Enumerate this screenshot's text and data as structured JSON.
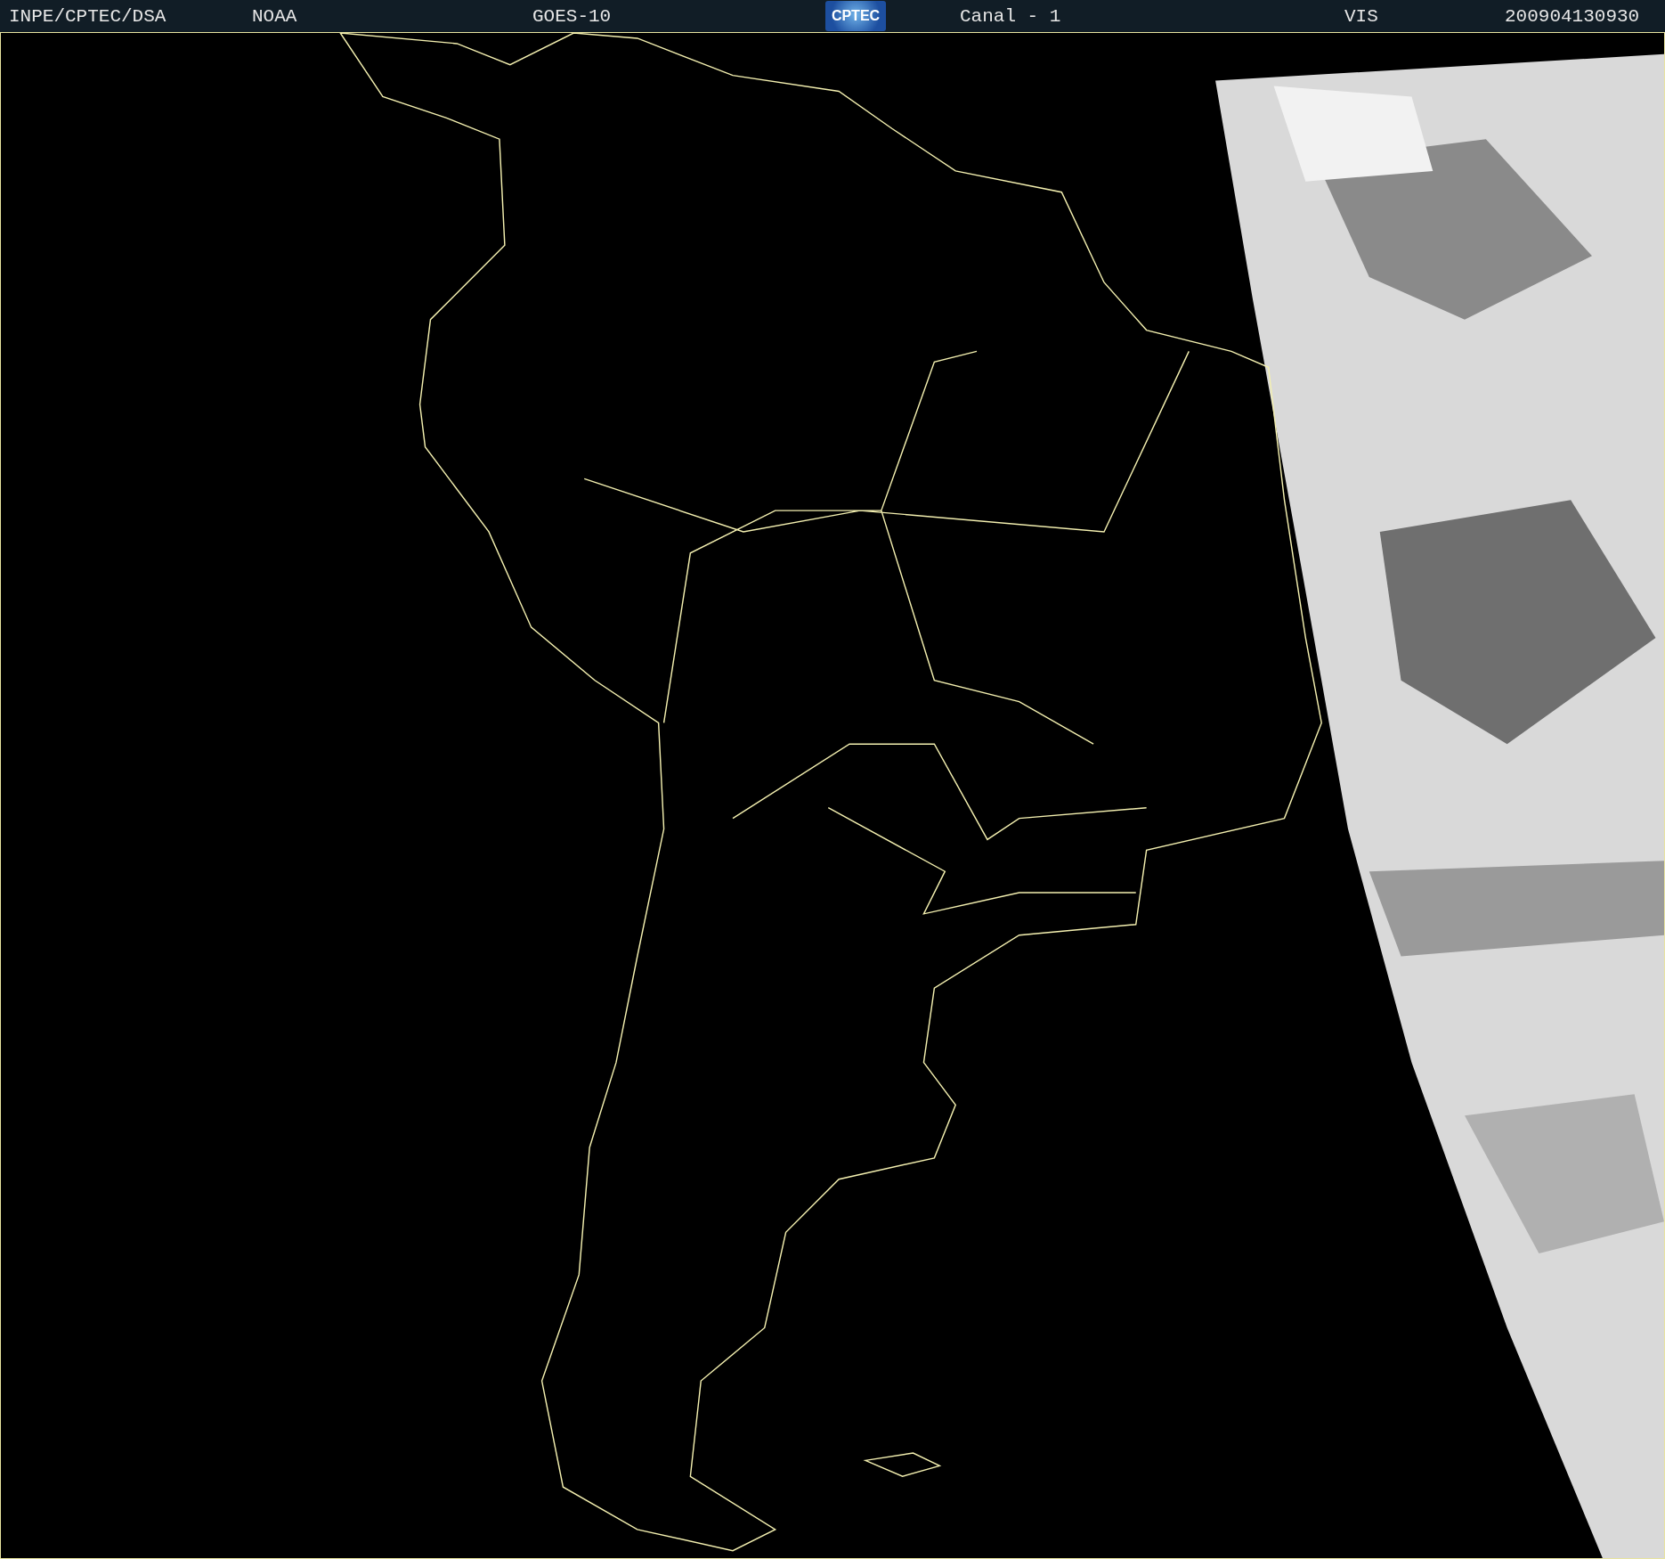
{
  "header": {
    "agency": "INPE/CPTEC/DSA",
    "source": "NOAA",
    "satellite": "GOES-10",
    "logo": "CPTEC",
    "channel": "Canal - 1",
    "band": "VIS",
    "timestamp": "200904130930"
  }
}
